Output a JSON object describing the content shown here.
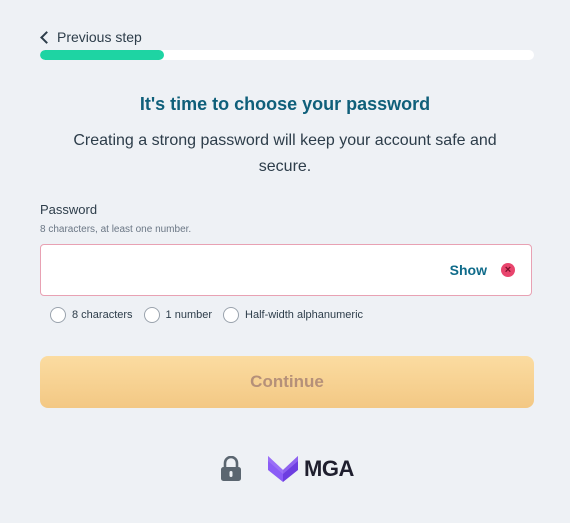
{
  "nav": {
    "previous_step": "Previous step"
  },
  "progress": {
    "fraction": 0.25
  },
  "header": {
    "title": "It's time to choose your password",
    "subtitle": "Creating a strong password will keep your account safe and secure."
  },
  "password_field": {
    "label": "Password",
    "hint": "8 characters, at least one number.",
    "value": "",
    "show_label": "Show",
    "error_icon": "close-circle-icon",
    "error_color": "#e8456d"
  },
  "requirements": [
    {
      "label": "8 characters"
    },
    {
      "label": "1 number"
    },
    {
      "label": "Half-width alphanumeric"
    }
  ],
  "continue_button": {
    "label": "Continue"
  },
  "footer": {
    "lock_icon": "lock-icon",
    "brand": "MGA",
    "brand_color": "#8b5cf6"
  },
  "colors": {
    "accent_teal": "#1ed4a3",
    "title_blue": "#0f5f7a",
    "button_orange": "#f3c884"
  }
}
